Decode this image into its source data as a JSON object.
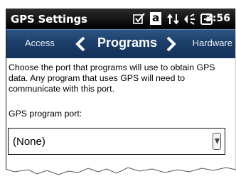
{
  "titlebar": {
    "app_title": "GPS Settings",
    "time": "3:56",
    "icons": [
      "checkbox-icon",
      "keyboard-a-icon",
      "connectivity-arrows-icon",
      "volume-icon",
      "battery-charging-icon"
    ],
    "keyboard_letter": "a"
  },
  "navbar": {
    "prev_tab": "Access",
    "current_tab": "Programs",
    "next_tab": "Hardware"
  },
  "content": {
    "description": "Choose the port that programs will use to obtain GPS data. Any program that uses GPS will need to communicate with this port.",
    "port_label": "GPS program port:",
    "port_value": "(None)"
  },
  "colors": {
    "titlebar": "#000000",
    "navbar": "#1c3e68",
    "text": "#000000"
  }
}
